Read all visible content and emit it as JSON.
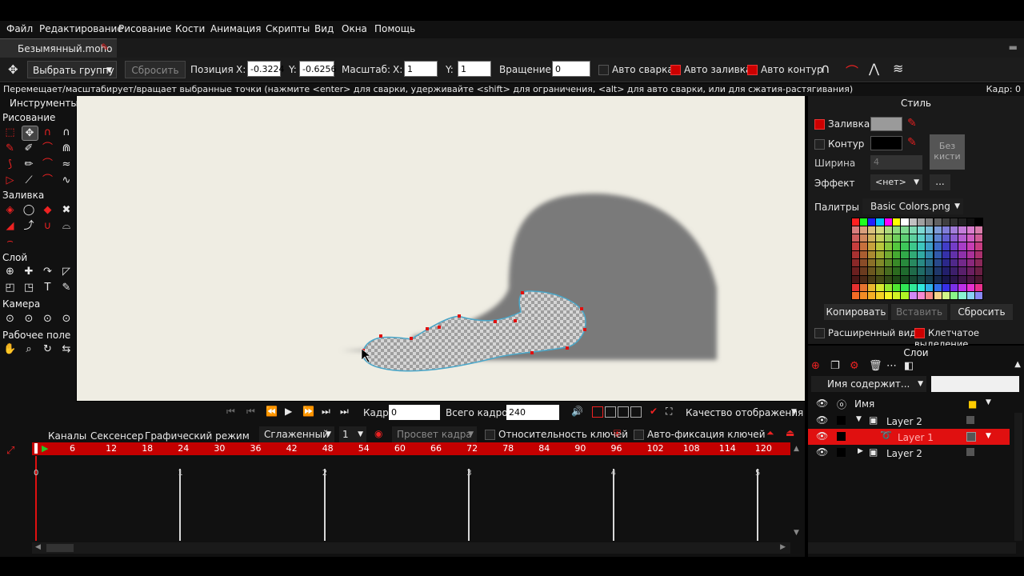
{
  "menu": [
    "Файл",
    "Редактирование",
    "Рисование",
    "Кости",
    "Анимация",
    "Скрипты",
    "Вид",
    "Окна",
    "Помощь"
  ],
  "document_tab": "Безымянный.moho",
  "toolbar": {
    "select_group": "Выбрать группу",
    "reset": "Сбросить",
    "position_label": "Позиция",
    "x_label": "X:",
    "x_value": "-0.3224",
    "y_label": "Y:",
    "y_value": "-0.6256",
    "scale_label": "Масштаб:",
    "scale_x_label": "X:",
    "scale_x": "1",
    "scale_y_label": "Y:",
    "scale_y": "1",
    "rotation_label": "Вращение",
    "rotation": "0",
    "auto_weld": "Авто сварка",
    "auto_fill": "Авто заливка",
    "auto_outline": "Авто контур"
  },
  "status": {
    "hint": "Перемещает/масштабирует/вращает выбранные точки (нажмите <enter> для сварки, удерживайте <shift> для ограничения, <alt> для авто сварки, или для сжатия-растягивания)",
    "frame": "Кадр: 0"
  },
  "tools": {
    "title": "Инструменты",
    "sections": [
      "Рисование",
      "Заливка",
      "Слой",
      "Камера",
      "Рабочее поле"
    ]
  },
  "style": {
    "title": "Стиль",
    "fill": "Заливка",
    "outline": "Контур",
    "no_brush": "Без кисти",
    "width": "Ширина",
    "width_value": "4",
    "effect": "Эффект",
    "effect_value": "<нет>",
    "more": "...",
    "palettes": "Палитры",
    "palette_file": "Basic Colors.png",
    "copy": "Копировать",
    "paste": "Вставить",
    "reset": "Сбросить",
    "advanced": "Расширенный вид",
    "checker": "Клетчатое выделение",
    "fill_color": "#9a9a9a",
    "outline_color": "#000000"
  },
  "layers": {
    "title": "Слои",
    "filter": "Имя содержит...",
    "name_col": "Имя",
    "rows": [
      {
        "name": "Layer 2",
        "selected": false
      },
      {
        "name": "Layer 1",
        "selected": true
      },
      {
        "name": "Layer 2",
        "selected": false
      }
    ]
  },
  "playback": {
    "frame_label": "Кадр:",
    "frame_value": "0",
    "total_label": "Всего кадров:",
    "total_value": "240",
    "quality": "Качество отображения"
  },
  "timeline": {
    "tabs": [
      "Каналы",
      "Сексенсер",
      "Графический режим"
    ],
    "smooth": "Сглаженный",
    "step": "1",
    "onion": "Просвет кадра",
    "relative_keys": "Относительность ключей",
    "auto_freeze": "Авто-фиксация ключей",
    "ruler_ticks": [
      "6",
      "12",
      "18",
      "24",
      "30",
      "36",
      "42",
      "48",
      "54",
      "60",
      "66",
      "72",
      "78",
      "84",
      "90",
      "96",
      "102",
      "108",
      "114",
      "120"
    ],
    "seconds": [
      "0",
      "1",
      "2",
      "3",
      "4",
      "5"
    ]
  },
  "colors": {
    "accent": "#e01010",
    "panel": "#1a1a1a",
    "canvas": "#efede3"
  }
}
